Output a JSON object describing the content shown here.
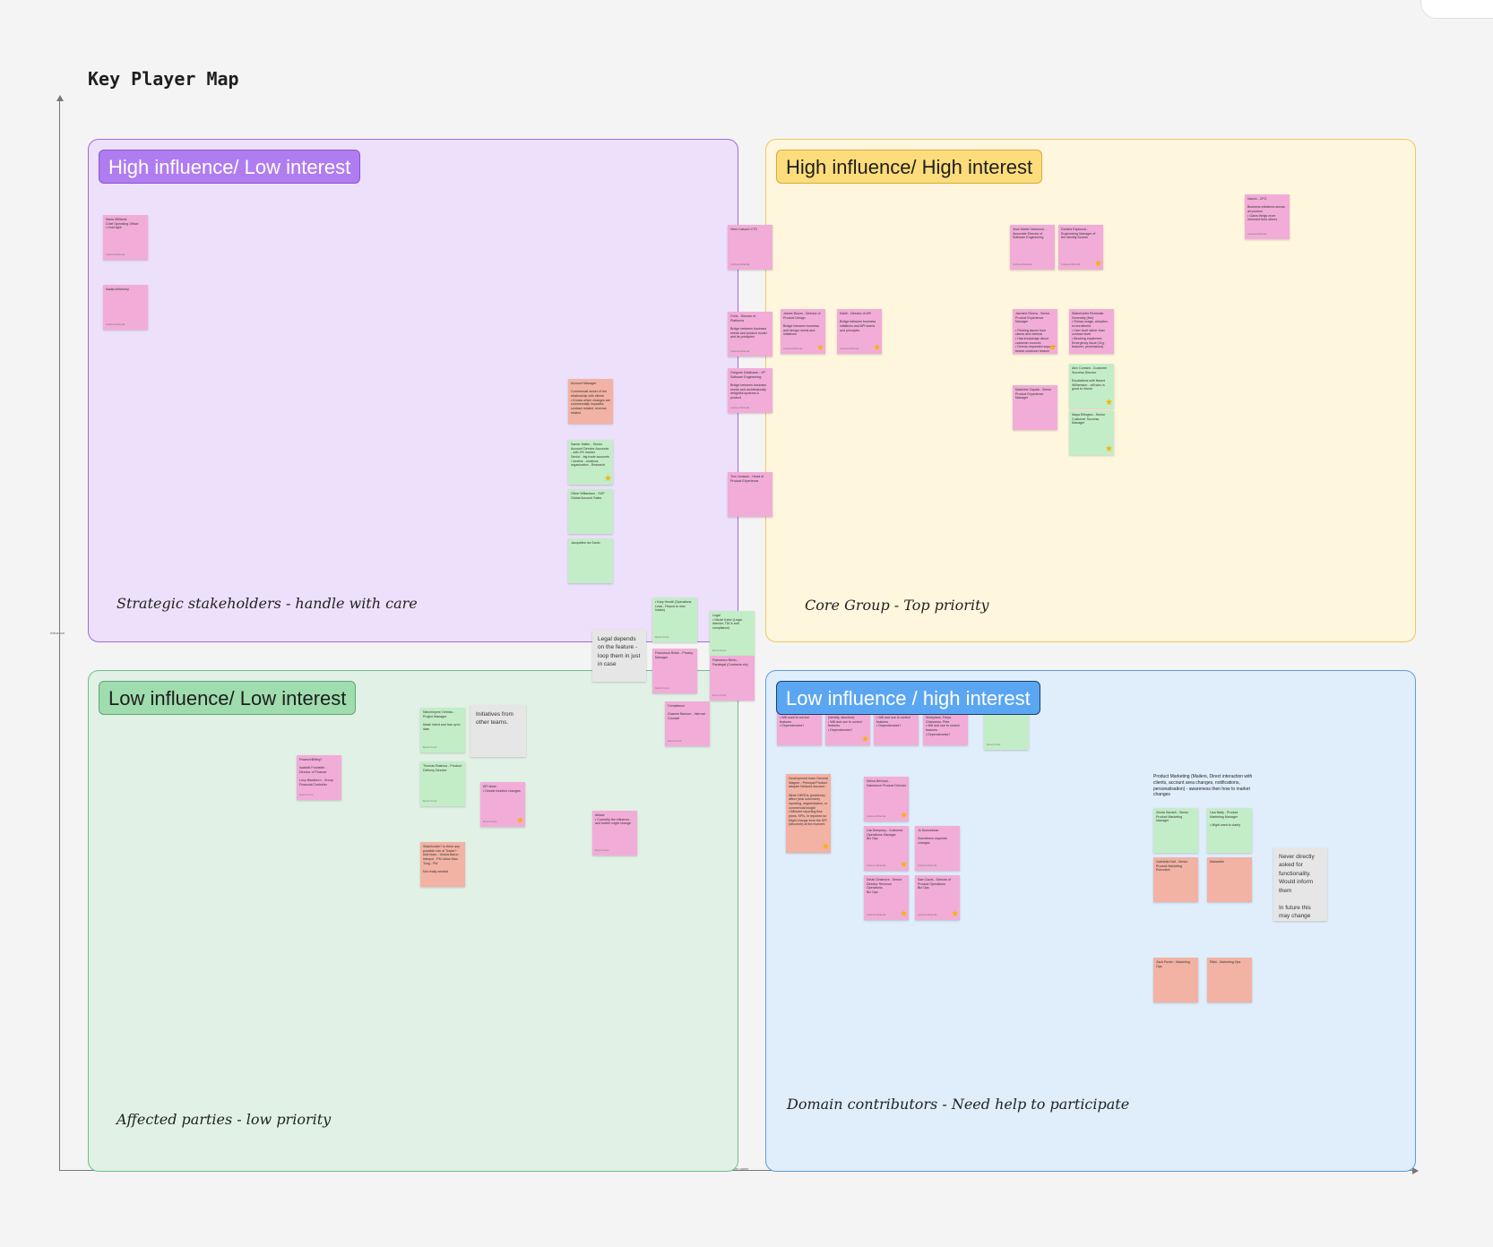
{
  "board": {
    "title": "Key Player Map",
    "axis_y_label": "Influence",
    "axis_x_label": "Interest in the game"
  },
  "quadrants": {
    "hl": {
      "label": "High influence/ Low interest",
      "caption": "Strategic stakeholders - handle with care"
    },
    "hh": {
      "label": "High influence/ High interest",
      "caption": "Core Group - Top priority"
    },
    "ll": {
      "label": "Low influence/ Low interest",
      "caption": "Affected parties - low priority"
    },
    "lh": {
      "label": "Low influence / high interest",
      "caption": "Domain contributors - Need help to participate"
    }
  },
  "notes": [
    {
      "id": "n1",
      "text": "Maria Williams\nChief Operating Officer\n• Hold tight",
      "author": "Andrea Miranda",
      "star": false
    },
    {
      "id": "n2",
      "text": "Nadia McMorley",
      "author": "Andrea Miranda",
      "star": false
    },
    {
      "id": "n3",
      "text": "Account Manager\n\nCommercial owner of the relationship with clients\n• Knows which changes are commercially impactful, contract related, revenue related",
      "author": "",
      "star": false
    },
    {
      "id": "n4",
      "text": "Samer Hatter - Senior Account Director Accounts - with 2% market\nSenior - big trade accounts / Inertive - relations organization - Research",
      "author": "",
      "star": true
    },
    {
      "id": "n5",
      "text": "Oliver Willardson - SVP Global Account Sales",
      "author": "",
      "star": false
    },
    {
      "id": "n6",
      "text": "Jacqueline da Santo",
      "author": "",
      "star": false
    },
    {
      "id": "n7",
      "text": "Veen Liasoch CTO",
      "author": "Andrea Miranda",
      "star": false
    },
    {
      "id": "n8",
      "text": "Chris - Director of Platforms\n\nBridge between business needs and product model and its principles",
      "author": "Andrea Miranda",
      "star": false
    },
    {
      "id": "n9",
      "text": "Grégoire Delafosse - VP Software Engineering\n\nBridge between business needs and architecturally delightful systems & product",
      "author": "Andrea Miranda",
      "star": false
    },
    {
      "id": "n10",
      "text": "Tom Jonsson - Head of Product Experience",
      "author": "",
      "star": false
    },
    {
      "id": "n11",
      "text": "James Bloom - Director of Product Design\n\nBridge between business and design needs and initiatives",
      "author": "Andrea Miranda",
      "star": true
    },
    {
      "id": "n12",
      "text": "Kahlil - Director of API\n\nBridge between business initiatives and API teams and principles",
      "author": "Andrea Miranda",
      "star": true
    },
    {
      "id": "n13",
      "text": "Jean Martin Vanhorne - Associate Director of Software Engineering",
      "author": "Andrea Miranda",
      "star": false
    },
    {
      "id": "n14",
      "text": "Daniela Espinoza - Engineering Manager of the Identity Access",
      "author": "Andrea Miranda",
      "star": true
    },
    {
      "id": "n15",
      "text": "Naomi - CPO\n\nBusiness initiatives across all product\n• Gains things more informed from others",
      "author": "Andrea Miranda",
      "star": false
    },
    {
      "id": "n16",
      "text": "Jasmine Rivera - Senior Product Experience Manager\n\n• Fielding issues from clients and internal\n• Has knowledge about customer sources\n• Demos requested support tickets customer feature requests",
      "author": "",
      "star": true
    },
    {
      "id": "n17",
      "text": "Madeline Zapata - Senior Product Experience Manager",
      "author": "",
      "star": false
    },
    {
      "id": "n18",
      "text": "Stakeholder Reminder\nGenerally (five)\n• Shows usage, adoption, re-enrollment\n• User level rather than contract level\n• Blocking implement. Emergency issue (Org, features, permissions)",
      "author": "",
      "star": false
    },
    {
      "id": "n19",
      "text": "Alex Contant - Customer Success Director\n\nEscalations with Naomi Williamson - will who is good to inform",
      "author": "",
      "star": true
    },
    {
      "id": "n20",
      "text": "Maya Ellington - Senior Customer Success Manager",
      "author": "",
      "star": true
    },
    {
      "id": "n21",
      "text": "• Kary Hewitt (Operations Lead - Report to new Intake)",
      "author": "Devin Frost",
      "star": false
    },
    {
      "id": "n22",
      "text": "Legal\n• Nicole Kahn (Legal director, T&Cs and compliance)",
      "author": "Devin Frost",
      "star": false
    },
    {
      "id": "n23",
      "text": "Francesca Rubin - Privacy Manager",
      "author": "Devin Frost",
      "star": false
    },
    {
      "id": "n24",
      "text": "Francesco Biello - Paralegal (Contracts etc)",
      "author": "Devin Frost",
      "star": false
    },
    {
      "id": "n25",
      "text": "Compliance\n\nGraeme Bannon - Internal Counsel",
      "author": "Devin Frost",
      "star": false
    },
    {
      "id": "n26",
      "text": "Finance/Billing?\n\nIsabelle Fondelier - Director of Finance\n\nLucy Blackburn - Group Financial Controller",
      "author": "Devin Frost",
      "star": false
    },
    {
      "id": "n27",
      "text": "Nkechinyere Orimba - Project Manager\n\nMade intent and has up to date",
      "author": "Devin Frost",
      "star": false
    },
    {
      "id": "n28",
      "text": "Thomas Rasmus - Product Delivery Director",
      "author": "Devin Frost",
      "star": false
    },
    {
      "id": "n29",
      "text": "Stakeholder? Is there any possible role of Trader? Add team - Ursula Baron Interpol - PM Julius Mau Tong - PM\n\nNot really needed",
      "author": "",
      "star": false
    },
    {
      "id": "n30",
      "text": "API team\n• Decide function changes",
      "author": "Devin Frost",
      "star": true
    },
    {
      "id": "n31",
      "text": "Allianz\n• Currently the influence - and further might change",
      "author": "Devin Frost",
      "star": false
    },
    {
      "id": "n32",
      "text": "• Will want to correct features\n• Dependencies?",
      "author": "",
      "star": false
    },
    {
      "id": "n33",
      "text": "(identity, structure)\n• Will and use to control features\n• Dependencies?",
      "author": "",
      "star": true
    },
    {
      "id": "n34",
      "text": "• Will and use to control features\n• Dependencies?",
      "author": "",
      "star": false
    },
    {
      "id": "n35",
      "text": "Workplace, Freya Chiesenko, Pete\n• Will and use to control features\n• Dependencies?",
      "author": "",
      "star": false
    },
    {
      "id": "n36",
      "text": "",
      "author": "Devin Frost",
      "star": false
    },
    {
      "id": "n37",
      "text": "Development team General Wagner - Principal Product adopter Network-focused -\n\nWhen HEROs (problems) affect (real outcomes) reporting, segmentation, or commercial insight\n• Affected reporting flow plans, KPIs, in reported so\nMight change from the KPI (structure) at the moment",
      "author": "",
      "star": true
    },
    {
      "id": "n38",
      "text": "Selina Bertucci - Salesforce Product Director",
      "author": "Andrea Miranda",
      "star": true
    },
    {
      "id": "n39",
      "text": "Lila Dempsey - Customer Operations Manager\nBiz Ops",
      "author": "Andrea Miranda",
      "star": true
    },
    {
      "id": "n40",
      "text": "Jo Dumonteau\n\nSometimes requests changes",
      "author": "Andrea Miranda",
      "star": false
    },
    {
      "id": "n41",
      "text": "Selah Dinsmore - Senior Director Revenue Operations\nBiz Ops",
      "author": "Andrea Miranda",
      "star": true
    },
    {
      "id": "n42",
      "text": "Sam Davis - Director of Product Operations\nBiz Ops",
      "author": "Andrea Miranda",
      "star": true
    },
    {
      "id": "n43",
      "text": "Zinnia Sacash - Senior Product Marketing Manager",
      "author": "",
      "star": false
    },
    {
      "id": "n44",
      "text": "Lisa Nalty - Product Marketing Manager\n\n• Might want to clarify",
      "author": "",
      "star": false
    },
    {
      "id": "n45",
      "text": "Gabriella Holt - Senior Product Marketing Executive",
      "author": "",
      "star": false
    },
    {
      "id": "n46",
      "text": "Marianthe",
      "author": "",
      "star": false
    },
    {
      "id": "n47",
      "text": "Zach Porter - Marketing Ops",
      "author": "",
      "star": false
    },
    {
      "id": "n48",
      "text": "Rikki - Marketing Ops",
      "author": "",
      "star": false
    }
  ],
  "grey_notes": {
    "legal": "Legal depends on the feature - loop them in just in case",
    "initiatives": "Initiatives from other teams.",
    "never": "Never directly asked for functionality. Would inform them\n\nIn future this may change"
  },
  "free_text": {
    "product_marketing": "Product Marketing (Mailers, Direct interaction with clients, account area changes, notifications, personalisation) - awareness then how to market changes"
  },
  "colors": {
    "pink": "#f2acd8",
    "green": "#c3edc7",
    "salmon": "#f2b2a4",
    "grey": "#e6e6e6",
    "purple_quadrant": "#ede0fb",
    "yellow_quadrant": "#fff6de",
    "green_quadrant": "#e1f1e6",
    "blue_quadrant": "#e0edfb"
  }
}
